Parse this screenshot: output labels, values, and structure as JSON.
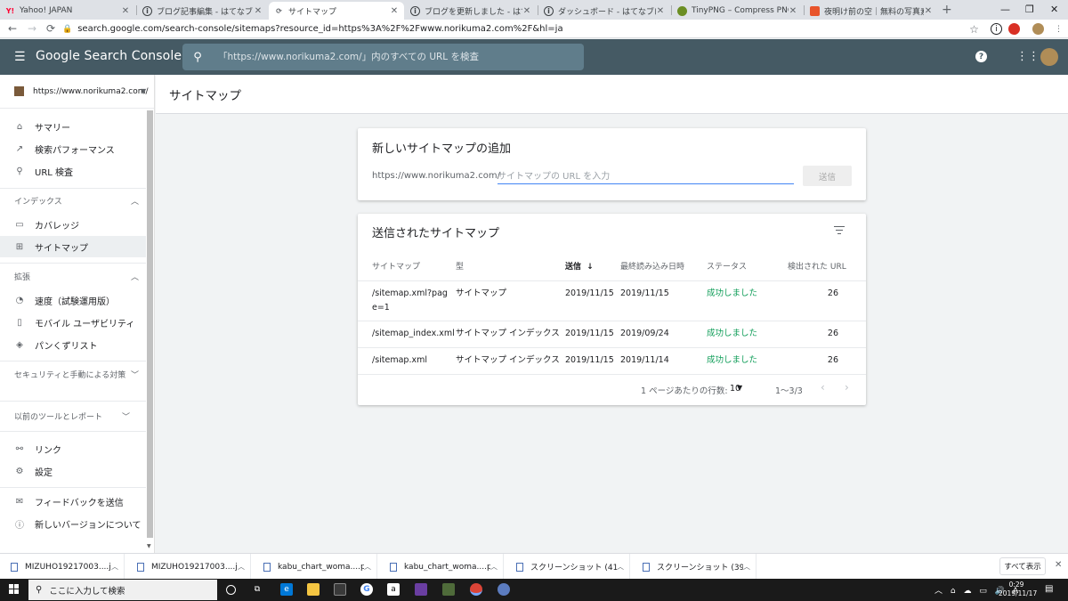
{
  "browser": {
    "tabs": [
      {
        "title": "Yahoo! JAPAN",
        "favicon": "Y!",
        "favicon_color": "#ff0033"
      },
      {
        "title": "ブログ記事編集 - はてなブログ",
        "favicon": "i",
        "favicon_color": "#3c4043"
      },
      {
        "title": "サイトマップ",
        "favicon": "sc",
        "favicon_color": "#5f6368"
      },
      {
        "title": "ブログを更新しました - はてなブログ",
        "favicon": "i",
        "favicon_color": "#3c4043"
      },
      {
        "title": "ダッシュボード - はてなブログ",
        "favicon": "i",
        "favicon_color": "#3c4043"
      },
      {
        "title": "TinyPNG – Compress PNG images",
        "favicon": "tp",
        "favicon_color": "#6b8e23"
      },
      {
        "title": "夜明け前の空｜無料の写真素材は",
        "favicon": "p",
        "favicon_color": "#e8542b"
      }
    ],
    "new_tab": "+",
    "window_controls": [
      "—",
      "❐",
      "✕"
    ],
    "url": "search.google.com/search-console/sitemaps?resource_id=https%3A%2F%2Fwww.norikuma2.com%2F&hl=ja"
  },
  "header": {
    "logo": "Google Search Console",
    "search_placeholder": "「https://www.norikuma2.com/」内のすべての URL を検査",
    "help": "?"
  },
  "sidebar": {
    "property": "https://www.norikuma2.com/",
    "items_top": [
      {
        "label": "サマリー",
        "icon": "home-icon",
        "glyph": "⌂"
      },
      {
        "label": "検索パフォーマンス",
        "icon": "trending-up-icon",
        "glyph": "↗"
      },
      {
        "label": "URL 検査",
        "icon": "search-icon",
        "glyph": "🔍"
      }
    ],
    "section_index": "インデックス",
    "items_index": [
      {
        "label": "カバレッジ",
        "icon": "coverage-icon",
        "glyph": "▭"
      },
      {
        "label": "サイトマップ",
        "icon": "sitemap-icon",
        "glyph": "⊞"
      }
    ],
    "section_enhance": "拡張",
    "items_enhance": [
      {
        "label": "速度（試験運用版）",
        "icon": "speed-icon",
        "glyph": "◔"
      },
      {
        "label": "モバイル ユーザビリティ",
        "icon": "mobile-icon",
        "glyph": "▯"
      },
      {
        "label": "パンくずリスト",
        "icon": "breadcrumb-icon",
        "glyph": "◈"
      }
    ],
    "section_security": "セキュリティと手動による対策",
    "section_legacy": "以前のツールとレポート",
    "items_bottom": [
      {
        "label": "リンク",
        "icon": "links-icon",
        "glyph": "⚲"
      },
      {
        "label": "設定",
        "icon": "settings-icon",
        "glyph": "⚙"
      }
    ],
    "items_feedback": [
      {
        "label": "フィードバックを送信",
        "icon": "feedback-icon",
        "glyph": "✉"
      },
      {
        "label": "新しいバージョンについて",
        "icon": "info-icon",
        "glyph": "ⓘ"
      }
    ]
  },
  "main": {
    "page_title": "サイトマップ",
    "add_card": {
      "title": "新しいサイトマップの追加",
      "prefix": "https://www.norikuma2.com/",
      "placeholder": "サイトマップの URL を入力",
      "submit": "送信"
    },
    "list_card": {
      "title": "送信されたサイトマップ",
      "columns": {
        "sitemap": "サイトマップ",
        "type": "型",
        "submitted": "送信",
        "last_read": "最終読み込み日時",
        "status": "ステータス",
        "urls": "検出された URL"
      },
      "rows": [
        {
          "sitemap": "/sitemap.xml?page=1",
          "type": "サイトマップ",
          "submitted": "2019/11/15",
          "last_read": "2019/11/15",
          "status": "成功しました",
          "urls": "26"
        },
        {
          "sitemap": "/sitemap_index.xml",
          "type": "サイトマップ インデックス",
          "submitted": "2019/11/15",
          "last_read": "2019/09/24",
          "status": "成功しました",
          "urls": "26"
        },
        {
          "sitemap": "/sitemap.xml",
          "type": "サイトマップ インデックス",
          "submitted": "2019/11/15",
          "last_read": "2019/11/14",
          "status": "成功しました",
          "urls": "26"
        }
      ],
      "pager": {
        "rows_per_page_label": "1 ページあたりの行数:",
        "rows_per_page": "10",
        "range": "1〜3/3"
      }
    }
  },
  "downloads": {
    "items": [
      "MIZUHO19217003....jpg",
      "MIZUHO19217003....jpg",
      "kabu_chart_woma....png",
      "kabu_chart_woma....png",
      "スクリーンショット (41).png",
      "スクリーンショット (39).png"
    ],
    "show_all": "すべて表示"
  },
  "taskbar": {
    "search_placeholder": "ここに入力して検索",
    "ime": "A",
    "time": "0:29",
    "date": "2019/11/17"
  }
}
